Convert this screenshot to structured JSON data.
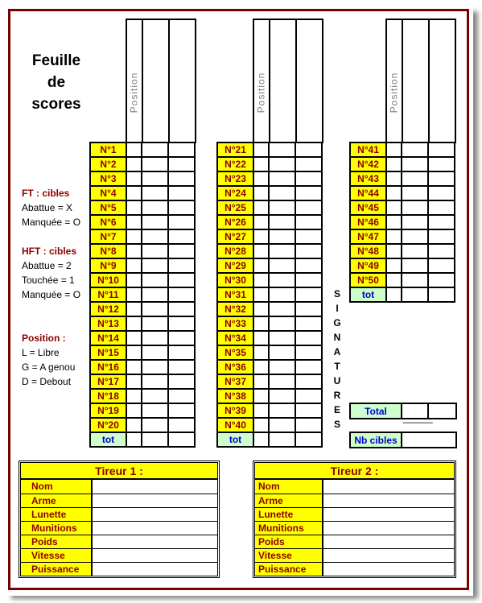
{
  "title": [
    "Feuille",
    "de",
    "scores"
  ],
  "legend": {
    "ft": {
      "heading": "FT : cibles",
      "lines": [
        "Abattue = X",
        "Manquée = O"
      ]
    },
    "hft": {
      "heading": "HFT : cibles",
      "lines": [
        "Abattue = 2",
        "Touchée = 1",
        "Manquée = O"
      ]
    },
    "position": {
      "heading": "Position :",
      "lines": [
        "L = Libre",
        "G = A genou",
        "D = Debout"
      ]
    }
  },
  "column_header": "Position",
  "blocks": [
    {
      "targets": [
        "N°1",
        "N°2",
        "N°3",
        "N°4",
        "N°5",
        "N°6",
        "N°7",
        "N°8",
        "N°9",
        "N°10",
        "N°11",
        "N°12",
        "N°13",
        "N°14",
        "N°15",
        "N°16",
        "N°17",
        "N°18",
        "N°19",
        "N°20"
      ],
      "total_label": "tot"
    },
    {
      "targets": [
        "N°21",
        "N°22",
        "N°23",
        "N°24",
        "N°25",
        "N°26",
        "N°27",
        "N°28",
        "N°29",
        "N°30",
        "N°31",
        "N°32",
        "N°33",
        "N°34",
        "N°35",
        "N°36",
        "N°37",
        "N°38",
        "N°39",
        "N°40"
      ],
      "total_label": "tot"
    },
    {
      "targets": [
        "N°41",
        "N°42",
        "N°43",
        "N°44",
        "N°45",
        "N°46",
        "N°47",
        "N°48",
        "N°49",
        "N°50"
      ],
      "total_label": "tot"
    }
  ],
  "signatures": [
    "S",
    "I",
    "G",
    "N",
    "A",
    "T",
    "U",
    "R",
    "E",
    "S"
  ],
  "summary": {
    "total_label": "Total",
    "nb_cibles_label": "Nb cibles",
    "separator": "----------------"
  },
  "shooters": [
    {
      "title": "Tireur 1 :",
      "fields": [
        "Nom",
        "Arme",
        "Lunette",
        "Munitions",
        "Poids",
        "Vitesse",
        "Puissance"
      ]
    },
    {
      "title": "Tireur 2 :",
      "fields": [
        "Nom",
        "Arme",
        "Lunette",
        "Munitions",
        "Poids",
        "Vitesse",
        "Puissance"
      ]
    }
  ],
  "colors": {
    "frame": "#7b0000",
    "label_bg": "#ffff00",
    "label_text": "#8b0000",
    "total_bg": "#ccffcc",
    "total_text": "#0000cc"
  }
}
